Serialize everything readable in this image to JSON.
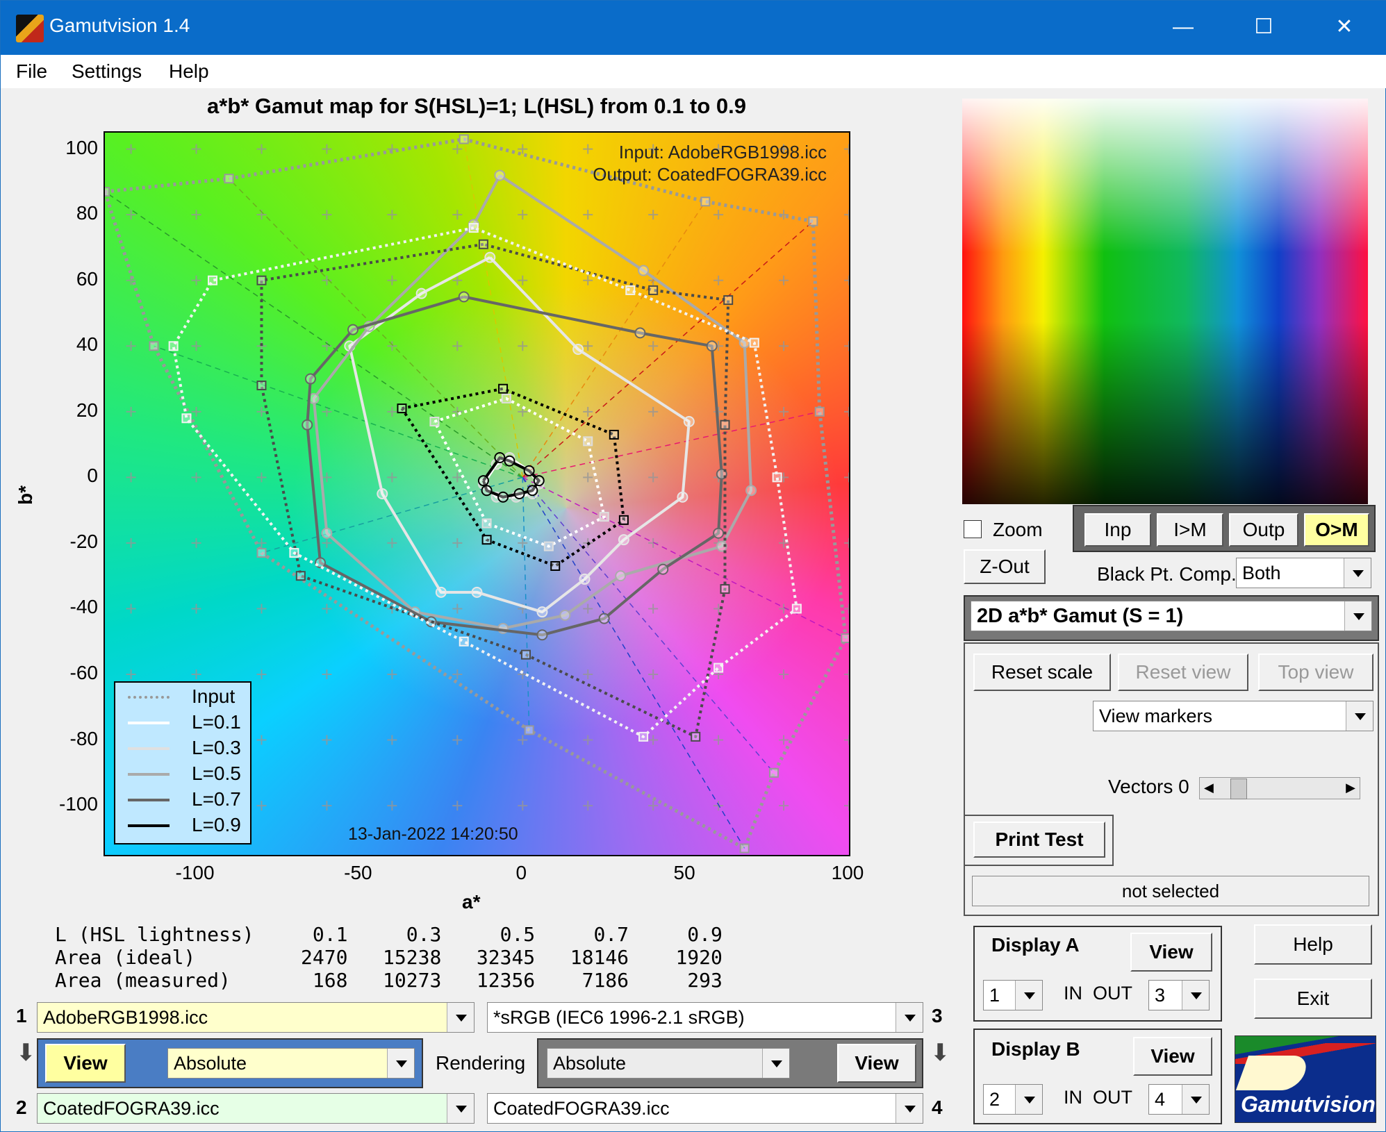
{
  "app": {
    "title": "Gamutvision 1.4"
  },
  "window_controls": {
    "minimize": "—",
    "maximize": "☐",
    "close": "✕"
  },
  "menu": [
    "File",
    "Settings",
    "Help"
  ],
  "plot": {
    "title": "a*b* Gamut map for S(HSL)=1; L(HSL) from 0.1 to 0.9",
    "input_profile": "Input:  AdobeRGB1998.icc",
    "output_profile": "Output: CoatedFOGRA39.icc",
    "date": "13-Jan-2022 14:20:50",
    "xlabel": "a*",
    "ylabel": "b*",
    "xticks": [
      "-100",
      "-50",
      "0",
      "50",
      "100"
    ],
    "yticks": [
      "100",
      "80",
      "60",
      "40",
      "20",
      "0",
      "-20",
      "-40",
      "-60",
      "-80",
      "-100"
    ]
  },
  "legend": [
    "Input",
    "L=0.1",
    "L=0.3",
    "L=0.5",
    "L=0.7",
    "L=0.9"
  ],
  "stats": {
    "header": "L (HSL lightness)     0.1     0.3     0.5     0.7     0.9",
    "ideal": "Area (ideal)         2470   15238   32345   18146    1920",
    "measured": "Area (measured)       168   10273   12356    7186     293"
  },
  "controls": {
    "zoom": "Zoom",
    "zout": "Z-Out",
    "mode_buttons": [
      "Inp",
      "I>M",
      "Outp",
      "O>M"
    ],
    "black_pt_label": "Black Pt. Comp.",
    "black_pt_value": "Both",
    "view_type": "2D a*b* Gamut (S = 1)",
    "reset_scale": "Reset scale",
    "reset_view": "Reset view",
    "top_view": "Top view",
    "view_markers": "View markers",
    "vectors": "Vectors 0",
    "print_test": "Print Test",
    "status": "not selected",
    "display_a": "Display A",
    "display_b": "Display B",
    "view": "View",
    "in_out": "IN  OUT",
    "a_in": "1",
    "a_out": "3",
    "b_in": "2",
    "b_out": "4",
    "help": "Help",
    "exit": "Exit",
    "logo_text": "Gamutvision"
  },
  "profiles": {
    "p1_num": "1",
    "p1": "AdobeRGB1998.icc",
    "p2_num": "2",
    "p2": "CoatedFOGRA39.icc",
    "p3_num": "3",
    "p3": "*sRGB   (IEC6 1996-2.1 sRGB)",
    "p4_num": "4",
    "p4": "CoatedFOGRA39.icc",
    "view_left": "View",
    "render_left": "Absolute",
    "rendering": "Rendering",
    "render_right": "Absolute",
    "view_right": "View"
  },
  "chart_data": {
    "type": "line",
    "title": "a*b* Gamut map for S(HSL)=1; L(HSL) from 0.1 to 0.9",
    "xlabel": "a*",
    "ylabel": "b*",
    "xlim": [
      -128,
      100
    ],
    "ylim": [
      -115,
      105
    ],
    "grid": true,
    "legend_position": "bottom-left",
    "series": [
      {
        "name": "Input",
        "style": "dotted",
        "color": "#999999",
        "points": [
          [
            -128,
            87
          ],
          [
            -90,
            91
          ],
          [
            -18,
            103
          ],
          [
            56,
            84
          ],
          [
            89,
            78
          ],
          [
            91,
            20
          ],
          [
            99,
            -49
          ],
          [
            77,
            -90
          ],
          [
            68,
            -113
          ],
          [
            2,
            -77
          ],
          [
            -80,
            -23
          ],
          [
            -113,
            40
          ],
          [
            -128,
            87
          ]
        ]
      },
      {
        "name": "L=0.1",
        "style": "solid",
        "color": "#ffffff",
        "points": [
          [
            -12,
            -2
          ],
          [
            -8,
            4
          ],
          [
            -4,
            6
          ],
          [
            2,
            2
          ],
          [
            5,
            -2
          ],
          [
            3,
            -5
          ],
          [
            -2,
            -6
          ],
          [
            -8,
            -6
          ],
          [
            -12,
            -2
          ]
        ]
      },
      {
        "name": "L=0.3",
        "style": "solid",
        "color": "#e6e6e6",
        "points": [
          [
            -10,
            67
          ],
          [
            17,
            39
          ],
          [
            51,
            17
          ],
          [
            49,
            -6
          ],
          [
            31,
            -19
          ],
          [
            19,
            -31
          ],
          [
            6,
            -41
          ],
          [
            -14,
            -35
          ],
          [
            -25,
            -35
          ],
          [
            -43,
            -5
          ],
          [
            -53,
            40
          ],
          [
            -31,
            56
          ],
          [
            -10,
            67
          ]
        ]
      },
      {
        "name": "L=0.5",
        "style": "solid",
        "color": "#aaaaaa",
        "points": [
          [
            -7,
            92
          ],
          [
            37,
            63
          ],
          [
            68,
            41
          ],
          [
            70,
            -4
          ],
          [
            61,
            -21
          ],
          [
            30,
            -30
          ],
          [
            13,
            -42
          ],
          [
            -6,
            -46
          ],
          [
            -33,
            -41
          ],
          [
            -60,
            -17
          ],
          [
            -64,
            24
          ],
          [
            -47,
            46
          ],
          [
            -15,
            77
          ],
          [
            -7,
            92
          ]
        ]
      },
      {
        "name": "L=0.7",
        "style": "solid",
        "color": "#666666",
        "points": [
          [
            -18,
            55
          ],
          [
            36,
            44
          ],
          [
            58,
            40
          ],
          [
            61,
            1
          ],
          [
            60,
            -17
          ],
          [
            43,
            -28
          ],
          [
            25,
            -43
          ],
          [
            6,
            -48
          ],
          [
            -28,
            -44
          ],
          [
            -62,
            -26
          ],
          [
            -66,
            16
          ],
          [
            -65,
            30
          ],
          [
            -52,
            45
          ],
          [
            -18,
            55
          ]
        ]
      },
      {
        "name": "L=0.9",
        "style": "solid",
        "color": "#000000",
        "points": [
          [
            -12,
            -1
          ],
          [
            -7,
            6
          ],
          [
            -4,
            5
          ],
          [
            2,
            2
          ],
          [
            5,
            -1
          ],
          [
            3,
            -4
          ],
          [
            -1,
            -5
          ],
          [
            -6,
            -6
          ],
          [
            -11,
            -4
          ],
          [
            -12,
            -1
          ]
        ]
      },
      {
        "name": "",
        "style": "dotted",
        "color": "#000000",
        "points": [
          [
            -37,
            21
          ],
          [
            -6,
            27
          ],
          [
            28,
            13
          ],
          [
            31,
            -13
          ],
          [
            10,
            -27
          ],
          [
            -11,
            -19
          ],
          [
            -37,
            21
          ]
        ]
      },
      {
        "name": "",
        "style": "dotted",
        "color": "#ffffff",
        "points": [
          [
            -27,
            17
          ],
          [
            -5,
            24
          ],
          [
            20,
            11
          ],
          [
            25,
            -12
          ],
          [
            8,
            -21
          ],
          [
            -11,
            -14
          ],
          [
            -27,
            17
          ]
        ]
      },
      {
        "name": "",
        "style": "dotted",
        "color": "#4a4a4a",
        "points": [
          [
            -12,
            71
          ],
          [
            -80,
            60
          ],
          [
            -80,
            28
          ],
          [
            -68,
            -30
          ],
          [
            1,
            -54
          ],
          [
            53,
            -79
          ],
          [
            62,
            -34
          ],
          [
            62,
            16
          ],
          [
            63,
            54
          ],
          [
            40,
            57
          ],
          [
            -12,
            71
          ]
        ]
      },
      {
        "name": "",
        "style": "dotted",
        "color": "#f2f2f2",
        "points": [
          [
            -15,
            76
          ],
          [
            -95,
            60
          ],
          [
            -107,
            40
          ],
          [
            -103,
            18
          ],
          [
            -70,
            -23
          ],
          [
            -18,
            -50
          ],
          [
            37,
            -79
          ],
          [
            60,
            -58
          ],
          [
            84,
            -40
          ],
          [
            78,
            0
          ],
          [
            71,
            41
          ],
          [
            33,
            57
          ],
          [
            -15,
            76
          ]
        ]
      }
    ]
  }
}
